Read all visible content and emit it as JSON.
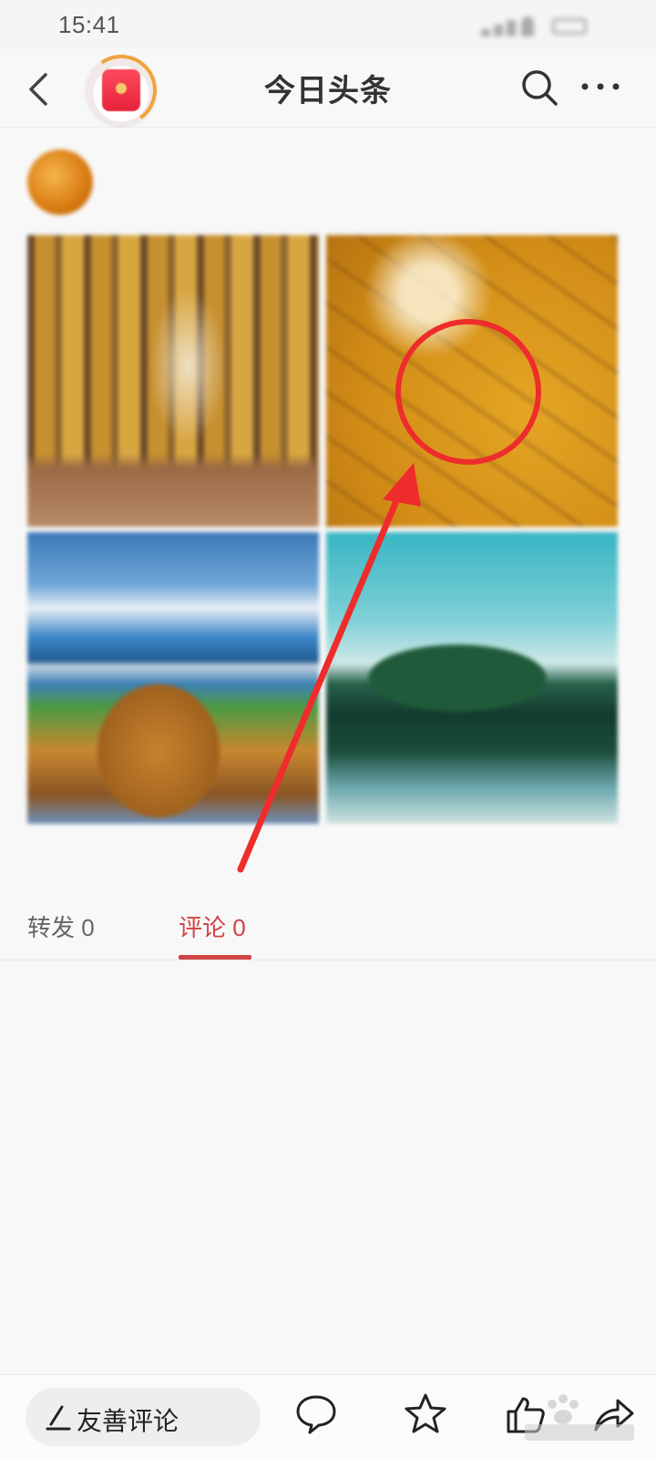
{
  "status_bar": {
    "time": "15:41"
  },
  "header": {
    "title": "今日头条"
  },
  "post": {
    "author_name": "",
    "post_time": "",
    "caption": ""
  },
  "tabs": {
    "forward": "转发 0",
    "comments": "评论 0",
    "like": ""
  },
  "comments": {
    "empty_hint": ""
  },
  "bottom_bar": {
    "comment_placeholder": "友善评论"
  },
  "icons": [
    "back-icon",
    "red-packet-icon",
    "search-icon",
    "more-icon",
    "comment-icon",
    "star-icon",
    "like-icon",
    "share-icon"
  ],
  "colors": {
    "accent": "#d24343",
    "annotation": "#ee2c2c"
  }
}
